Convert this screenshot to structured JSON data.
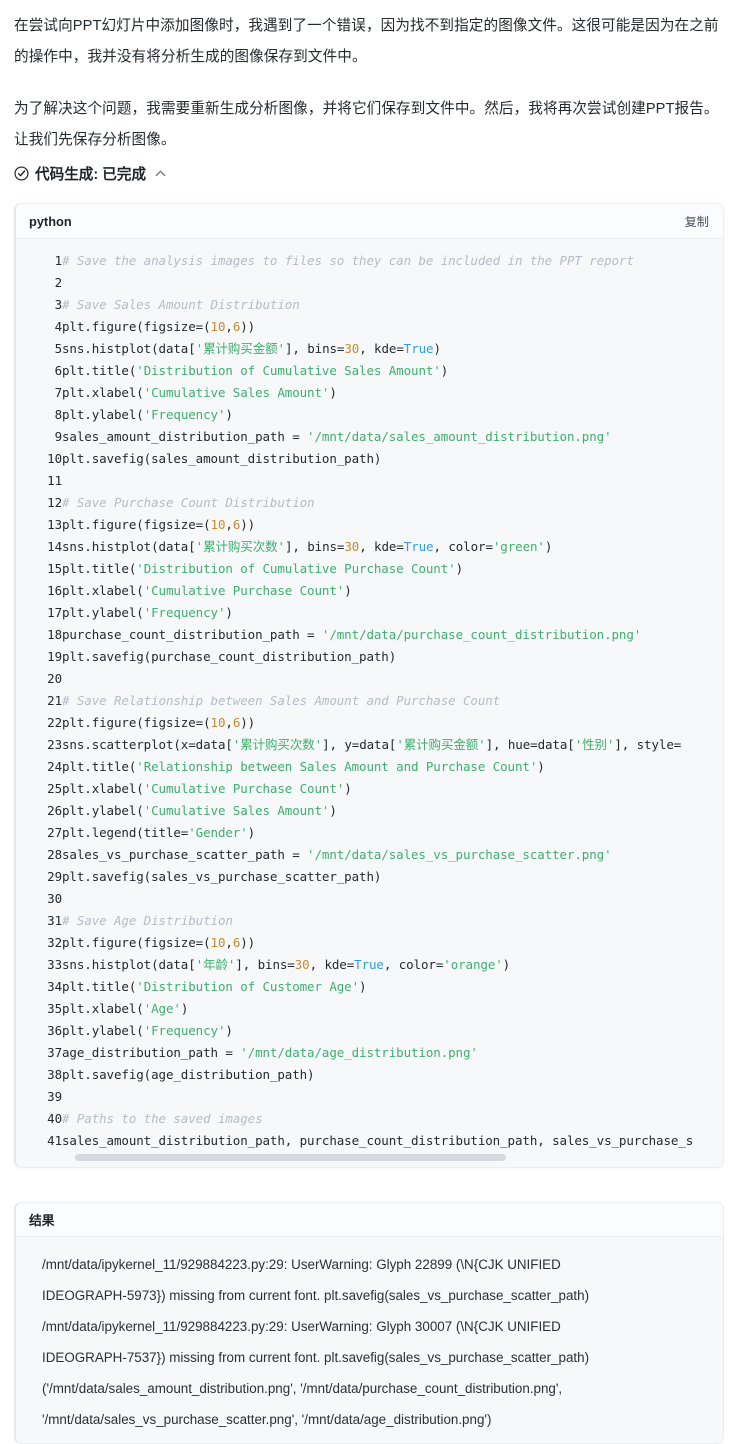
{
  "prose": {
    "paragraph_1": "在尝试向PPT幻灯片中添加图像时，我遇到了一个错误，因为找不到指定的图像文件。这很可能是因为在之前的操作中，我并没有将分析生成的图像保存到文件中。",
    "paragraph_2": "为了解决这个问题，我需要重新生成分析图像，并将它们保存到文件中。然后，我将再次尝试创建PPT报告。让我们先保存分析图像。"
  },
  "status": {
    "icon": "check-circle-icon",
    "label": "代码生成: 已完成",
    "chevron": "chevron-up-icon"
  },
  "code_block": {
    "language": "python",
    "copy_label": "复制",
    "line_numbers": [
      "1",
      "2",
      "3",
      "4",
      "5",
      "6",
      "7",
      "8",
      "9",
      "10",
      "11",
      "12",
      "13",
      "14",
      "15",
      "16",
      "17",
      "18",
      "19",
      "20",
      "21",
      "22",
      "23",
      "24",
      "25",
      "26",
      "27",
      "28",
      "29",
      "30",
      "31",
      "32",
      "33",
      "34",
      "35",
      "36",
      "37",
      "38",
      "39",
      "40",
      "41"
    ],
    "lines": [
      "# Save the analysis images to files so they can be included in the PPT report",
      "",
      "# Save Sales Amount Distribution",
      "plt.figure(figsize=(10,6))",
      "sns.histplot(data['累计购买金额'], bins=30, kde=True)",
      "plt.title('Distribution of Cumulative Sales Amount')",
      "plt.xlabel('Cumulative Sales Amount')",
      "plt.ylabel('Frequency')",
      "sales_amount_distribution_path = '/mnt/data/sales_amount_distribution.png'",
      "plt.savefig(sales_amount_distribution_path)",
      "",
      "# Save Purchase Count Distribution",
      "plt.figure(figsize=(10,6))",
      "sns.histplot(data['累计购买次数'], bins=30, kde=True, color='green')",
      "plt.title('Distribution of Cumulative Purchase Count')",
      "plt.xlabel('Cumulative Purchase Count')",
      "plt.ylabel('Frequency')",
      "purchase_count_distribution_path = '/mnt/data/purchase_count_distribution.png'",
      "plt.savefig(purchase_count_distribution_path)",
      "",
      "# Save Relationship between Sales Amount and Purchase Count",
      "plt.figure(figsize=(10,6))",
      "sns.scatterplot(x=data['累计购买次数'], y=data['累计购买金额'], hue=data['性别'], style=",
      "plt.title('Relationship between Sales Amount and Purchase Count')",
      "plt.xlabel('Cumulative Purchase Count')",
      "plt.ylabel('Cumulative Sales Amount')",
      "plt.legend(title='Gender')",
      "sales_vs_purchase_scatter_path = '/mnt/data/sales_vs_purchase_scatter.png'",
      "plt.savefig(sales_vs_purchase_scatter_path)",
      "",
      "# Save Age Distribution",
      "plt.figure(figsize=(10,6))",
      "sns.histplot(data['年龄'], bins=30, kde=True, color='orange')",
      "plt.title('Distribution of Customer Age')",
      "plt.xlabel('Age')",
      "plt.ylabel('Frequency')",
      "age_distribution_path = '/mnt/data/age_distribution.png'",
      "plt.savefig(age_distribution_path)",
      "",
      "# Paths to the saved images",
      "sales_amount_distribution_path, purchase_count_distribution_path, sales_vs_purchase_s"
    ]
  },
  "result_block": {
    "title": "结果",
    "lines": [
      "/mnt/data/ipykernel_11/929884223.py:29: UserWarning: Glyph 22899 (\\N{CJK UNIFIED",
      "IDEOGRAPH-5973}) missing from current font. plt.savefig(sales_vs_purchase_scatter_path)",
      "/mnt/data/ipykernel_11/929884223.py:29: UserWarning: Glyph 30007 (\\N{CJK UNIFIED",
      "IDEOGRAPH-7537}) missing from current font. plt.savefig(sales_vs_purchase_scatter_path)",
      "('/mnt/data/sales_amount_distribution.png', '/mnt/data/purchase_count_distribution.png',",
      "'/mnt/data/sales_vs_purchase_scatter.png', '/mnt/data/age_distribution.png')"
    ]
  },
  "colors": {
    "text": "#24292e",
    "comment": "#b6bcc4",
    "string": "#3eaf6f",
    "number": "#c78a2e",
    "keyword": "#2f9fd6",
    "code_bg": "#f7f8fa",
    "card_head_bg": "#fbfcfd"
  }
}
